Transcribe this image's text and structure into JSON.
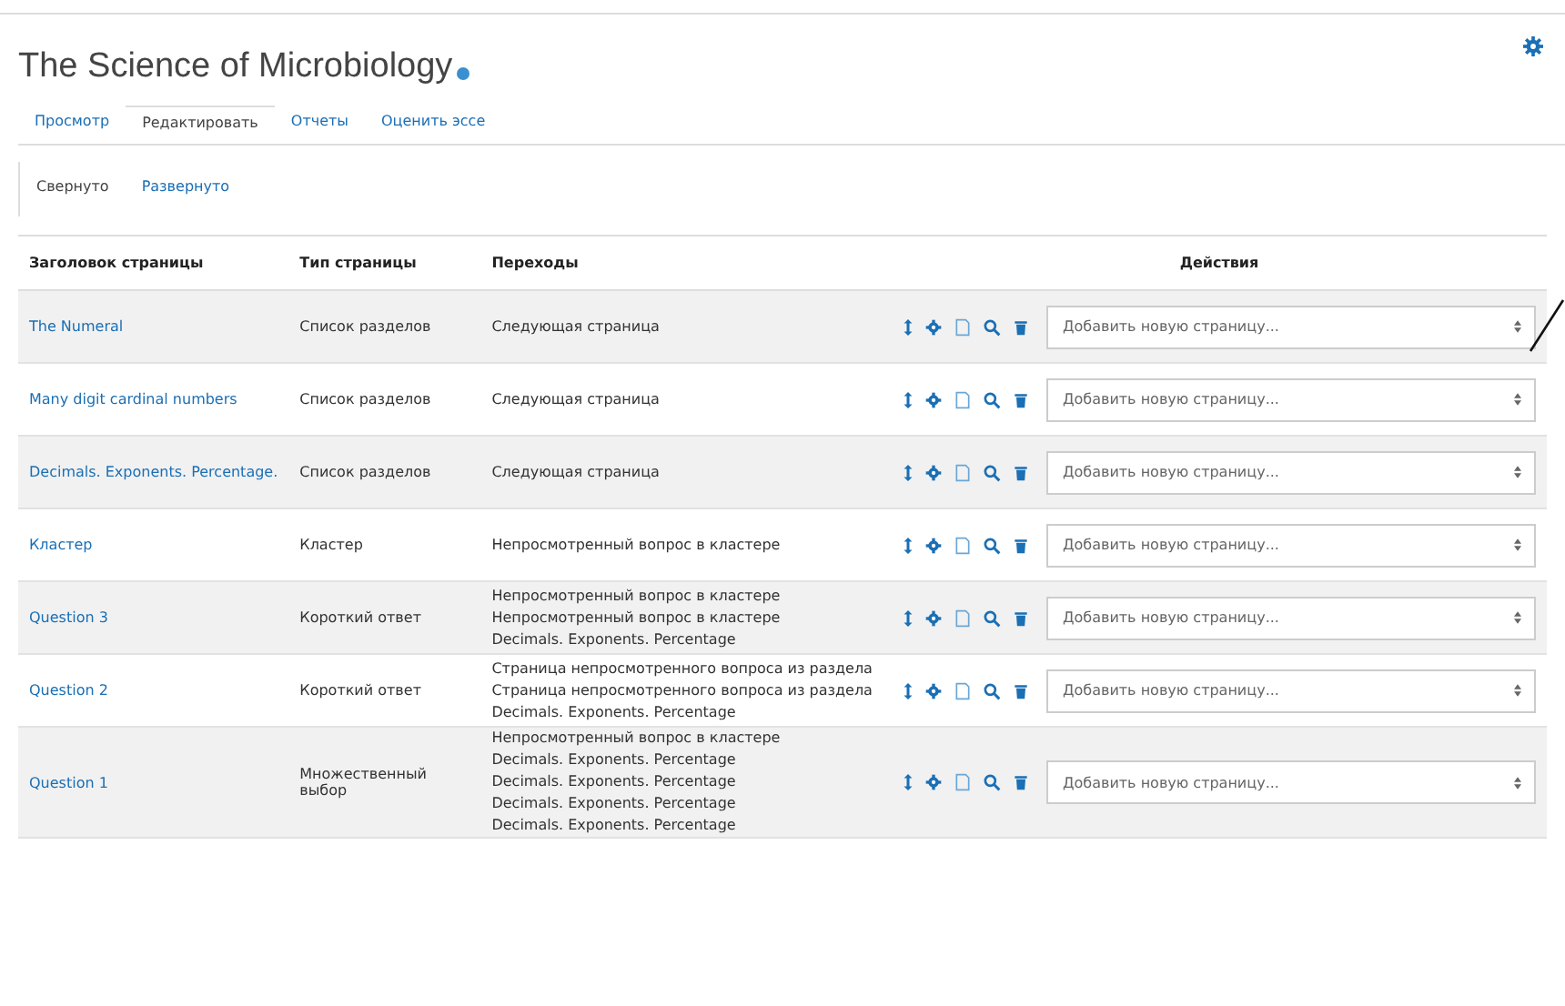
{
  "page": {
    "title": "The Science of Microbiology"
  },
  "tabs": [
    {
      "label": "Просмотр",
      "selected": false
    },
    {
      "label": "Редактировать",
      "selected": true
    },
    {
      "label": "Отчеты",
      "selected": false
    },
    {
      "label": "Оценить эссе",
      "selected": false
    }
  ],
  "view_tabs": [
    {
      "label": "Свернуто",
      "selected": true
    },
    {
      "label": "Развернуто",
      "selected": false
    }
  ],
  "table": {
    "columns": [
      "Заголовок страницы",
      "Тип страницы",
      "Переходы",
      "Действия"
    ],
    "rows": [
      {
        "title": "The Numeral",
        "type": "Список разделов",
        "jumps": [
          "Следующая страница"
        ],
        "add_page": "Добавить новую страницу..."
      },
      {
        "title": "Many digit cardinal numbers",
        "type": "Список разделов",
        "jumps": [
          "Следующая страница"
        ],
        "add_page": "Добавить новую страницу..."
      },
      {
        "title": "Decimals. Exponents. Percentage.",
        "type": "Список разделов",
        "jumps": [
          "Следующая страница"
        ],
        "add_page": "Добавить новую страницу..."
      },
      {
        "title": "Кластер",
        "type": "Кластер",
        "jumps": [
          "Непросмотренный вопрос в кластере"
        ],
        "add_page": "Добавить новую страницу..."
      },
      {
        "title": "Question 3",
        "type": "Короткий ответ",
        "jumps": [
          "Непросмотренный вопрос в кластере",
          "Непросмотренный вопрос в кластере",
          "Decimals. Exponents. Percentage"
        ],
        "add_page": "Добавить новую страницу..."
      },
      {
        "title": "Question 2",
        "type": "Короткий ответ",
        "jumps": [
          "Страница непросмотренного вопроса из раздела",
          "Страница непросмотренного вопроса из раздела",
          "Decimals. Exponents. Percentage"
        ],
        "add_page": "Добавить новую страницу..."
      },
      {
        "title": "Question 1",
        "type": "Множественный выбор",
        "jumps": [
          "Непросмотренный вопрос в кластере",
          "Decimals. Exponents. Percentage",
          "Decimals. Exponents. Percentage",
          "Decimals. Exponents. Percentage",
          "Decimals. Exponents. Percentage"
        ],
        "add_page": "Добавить новую страницу..."
      }
    ]
  }
}
